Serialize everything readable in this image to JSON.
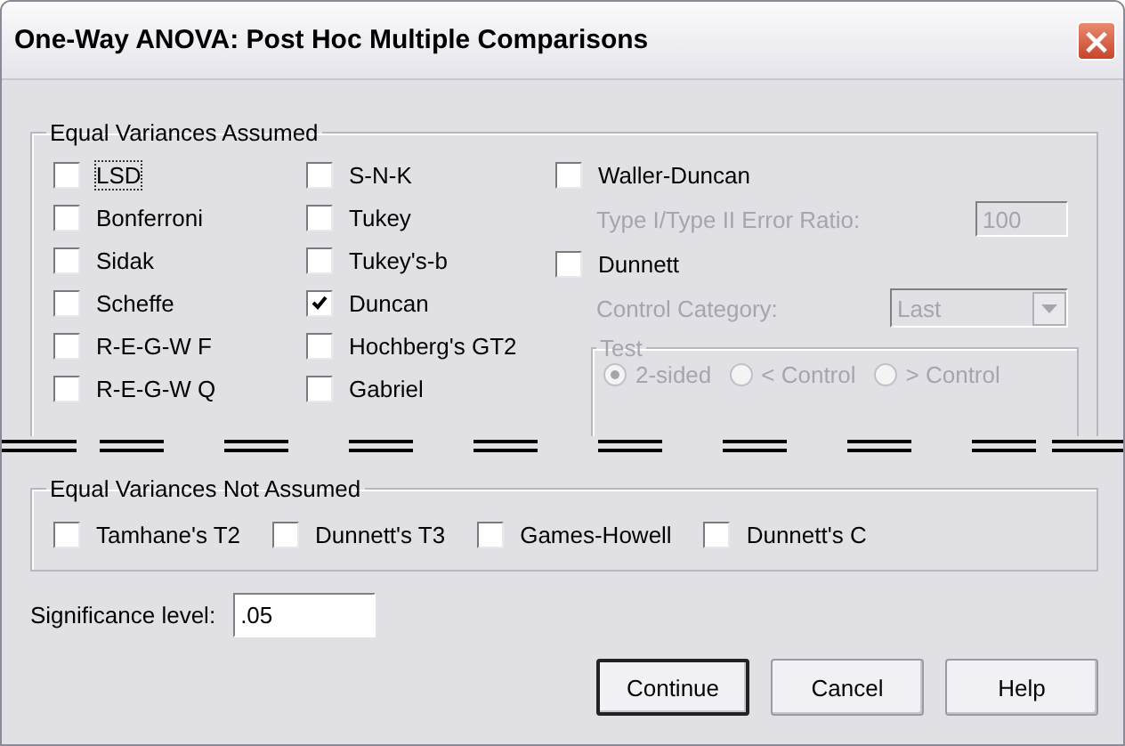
{
  "window": {
    "title": "One-Way ANOVA: Post Hoc Multiple Comparisons",
    "close": "×"
  },
  "assumed": {
    "title": "Equal Variances Assumed",
    "columns": [
      [
        {
          "kind": "checkbox",
          "label": "LSD",
          "checked": false,
          "focused": true
        },
        {
          "kind": "checkbox",
          "label": "Bonferroni",
          "checked": false
        },
        {
          "kind": "checkbox",
          "label": "Sidak",
          "checked": false
        },
        {
          "kind": "checkbox",
          "label": "Scheffe",
          "checked": false
        },
        {
          "kind": "checkbox",
          "label": "R-E-G-W F",
          "checked": false
        },
        {
          "kind": "checkbox",
          "label": "R-E-G-W Q",
          "checked": false
        }
      ],
      [
        {
          "kind": "checkbox",
          "label": "S-N-K",
          "checked": false
        },
        {
          "kind": "checkbox",
          "label": "Tukey",
          "checked": false
        },
        {
          "kind": "checkbox",
          "label": "Tukey's-b",
          "checked": false
        },
        {
          "kind": "checkbox",
          "label": "Duncan",
          "checked": true
        },
        {
          "kind": "checkbox",
          "label": "Hochberg's GT2",
          "checked": false
        },
        {
          "kind": "checkbox",
          "label": "Gabriel",
          "checked": false
        }
      ],
      [
        {
          "kind": "checkbox",
          "label": "Waller-Duncan",
          "checked": false
        },
        {
          "kind": "field",
          "label": "Type I/Type II Error Ratio:",
          "value": "100",
          "disabled": true
        },
        {
          "kind": "checkbox",
          "label": "Dunnett",
          "checked": false
        },
        {
          "kind": "dropdown",
          "label": "Control Category:",
          "value": "Last",
          "disabled": true
        },
        {
          "kind": "radios",
          "title": "Test",
          "disabled": true,
          "options": [
            {
              "label": "2-sided",
              "selected": true
            },
            {
              "label": "< Control",
              "selected": false
            },
            {
              "label": "> Control",
              "selected": false
            }
          ]
        }
      ]
    ]
  },
  "not_assumed": {
    "title": "Equal Variances Not Assumed",
    "items": [
      {
        "label": "Tamhane's T2",
        "checked": false
      },
      {
        "label": "Dunnett's T3",
        "checked": false
      },
      {
        "label": "Games-Howell",
        "checked": false
      },
      {
        "label": "Dunnett's C",
        "checked": false
      }
    ]
  },
  "significance": {
    "label": "Significance level:",
    "value": ".05"
  },
  "buttons": [
    {
      "label": "Continue",
      "default": true
    },
    {
      "label": "Cancel",
      "default": false
    },
    {
      "label": "Help",
      "default": false
    }
  ]
}
